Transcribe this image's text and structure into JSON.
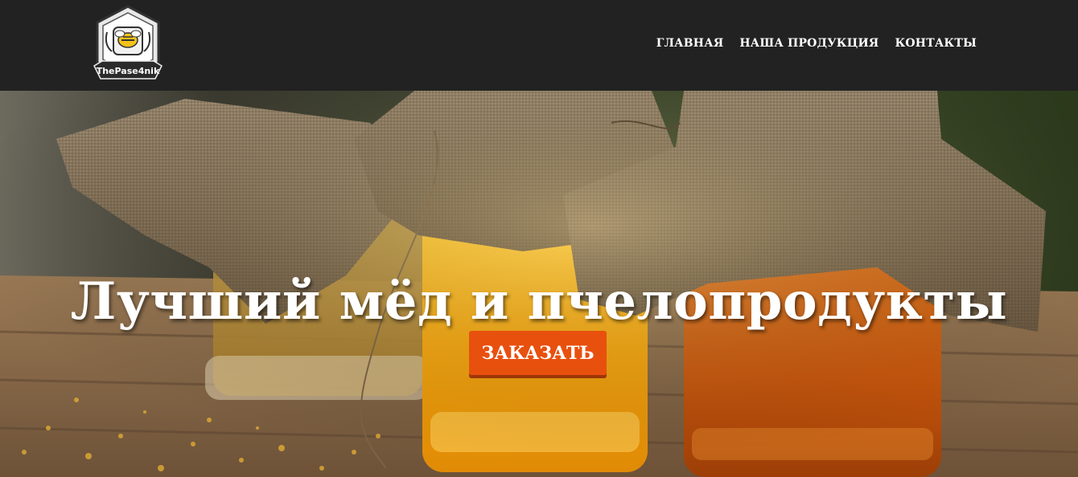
{
  "header": {
    "logo_text": "ThePase4nik",
    "nav": [
      {
        "label": "ГЛАВНАЯ"
      },
      {
        "label": "НАША ПРОДУКЦИЯ"
      },
      {
        "label": "КОНТАКТЫ"
      }
    ]
  },
  "hero": {
    "headline": "Лучший мёд и пчелопродукты",
    "cta_label": "ЗАКАЗАТЬ"
  },
  "colors": {
    "topbar": "#222222",
    "cta": "#e8500e",
    "text": "#ffffff"
  }
}
